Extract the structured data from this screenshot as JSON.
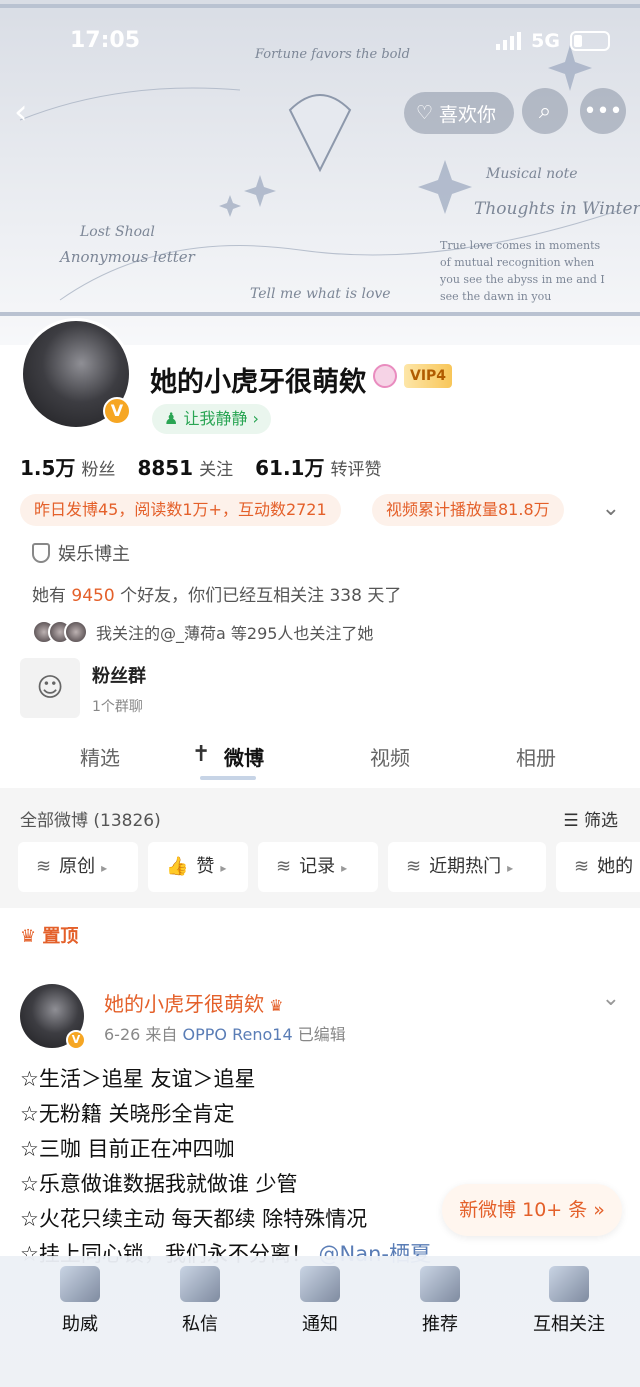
{
  "status_bar": {
    "time": "17:05",
    "network": "5G"
  },
  "header": {
    "back_icon": "chevron-left-icon",
    "like_label": "喜欢你",
    "search_icon": "search-icon",
    "more_icon": "more-icon",
    "banner_texts": [
      "Fortune favors the bold",
      "Musical note",
      "Thoughts in Winter",
      "True love comes in moments of mutual recognition when you see the abyss in me and I see the dawn in you",
      "Lost Shoal",
      "Anonymous letter",
      "Tell me what is love"
    ]
  },
  "profile": {
    "name": "她的小虎牙很萌欸",
    "verified_badge": "V",
    "vip_label": "VIP4",
    "tag": "让我静静",
    "stats": [
      {
        "value": "1.5万",
        "label": "粉丝"
      },
      {
        "value": "8851",
        "label": "关注"
      },
      {
        "value": "61.1万",
        "label": "转评赞"
      }
    ],
    "pill_left": "昨日发博45，阅读数1万+，互动数2721",
    "pill_right": "视频累计播放量81.8万",
    "certification": "娱乐博主",
    "friends_pre": "她有",
    "friends_count": "9450",
    "friends_post": "个好友，你们已经互相关注 338 天了",
    "mutual_text": "我关注的@_薄荷a 等295人也关注了她"
  },
  "fan_group": {
    "title": "粉丝群",
    "sub": "1个群聊"
  },
  "tabs": [
    {
      "label": "精选"
    },
    {
      "label": "微博"
    },
    {
      "label": "视频"
    },
    {
      "label": "相册"
    }
  ],
  "feed": {
    "all_label": "全部微博 (13826)",
    "filter_label": "筛选",
    "chips": [
      "原创",
      "赞",
      "记录",
      "近期热门",
      "她的"
    ]
  },
  "post": {
    "pinned_label": "置顶",
    "author": "她的小虎牙很萌欸",
    "date": "6-26",
    "source_prefix": "来自",
    "device": "OPPO Reno14",
    "edited": "已编辑",
    "lines": [
      "☆生活＞追星 友谊＞追星",
      "☆无粉籍 关晓彤全肯定",
      "☆三咖 目前正在冲四咖",
      "☆乐意做谁数据我就做谁 少管",
      "☆火花只续主动 每天都续 除特殊情况"
    ],
    "last_line_text": "☆挂上同心锁，我们永不分离！",
    "last_line_at": "@Nan-栖夏",
    "new_weibo": "新微博 10+ 条"
  },
  "bottom_bar": [
    {
      "label": "助威",
      "icon": "cross-icon"
    },
    {
      "label": "私信",
      "icon": "message-icon"
    },
    {
      "label": "通知",
      "icon": "bell-icon"
    },
    {
      "label": "推荐",
      "icon": "stack-icon"
    },
    {
      "label": "互相关注",
      "icon": "bird-icon"
    }
  ],
  "colors": {
    "accent": "#e4602a",
    "link": "#5a7db6",
    "green": "#2aa554"
  }
}
